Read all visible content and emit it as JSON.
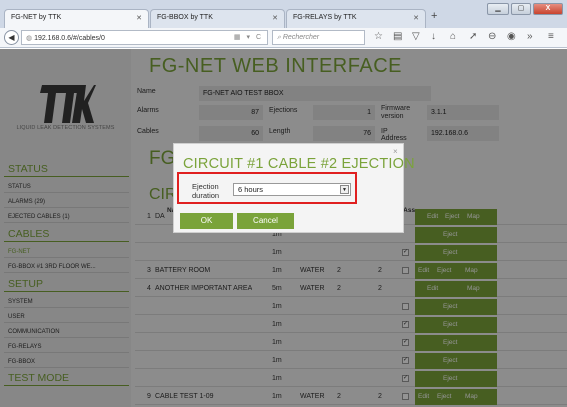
{
  "browser": {
    "tabs": [
      {
        "title": "FG-NET by TTK",
        "active": true
      },
      {
        "title": "FG-BBOX by TTK",
        "active": false
      },
      {
        "title": "FG-RELAYS by TTK",
        "active": false
      }
    ],
    "new_tab": "+",
    "address": "192.168.0.6/#/cables/0",
    "search_placeholder": "Rechercher"
  },
  "sidebar": {
    "logo_text": "TTK",
    "tagline": "LIQUID LEAK DETECTION SYSTEMS",
    "sections": [
      {
        "title": "STATUS",
        "items": [
          "STATUS",
          "ALARMS (29)",
          "EJECTED CABLES (1)"
        ]
      },
      {
        "title": "CABLES",
        "items": [
          "FG-NET",
          "FG-BBOX #1 3RD FLOOR WE..."
        ]
      },
      {
        "title": "SETUP",
        "items": [
          "SYSTEM",
          "USER",
          "COMMUNICATION",
          "FG-RELAYS",
          "FG-BBOX"
        ]
      },
      {
        "title": "TEST MODE",
        "items": []
      }
    ],
    "current_item": "FG-NET"
  },
  "main": {
    "title": "FG-NET WEB INTERFACE",
    "info": {
      "name_label": "Name",
      "name_value": "FG-NET AIO TEST BBOX",
      "alarms_label": "Alarms",
      "alarms_value": "87",
      "ejections_label": "Ejections",
      "ejections_value": "1",
      "firmware_label": "Firmware version",
      "firmware_value": "3.1.1",
      "cables_label": "Cables",
      "cables_value": "60",
      "length_label": "Length",
      "length_value": "76",
      "ip_label": "IP Address",
      "ip_value": "192.168.0.6"
    },
    "section_partial_1": "FG",
    "section_partial_2": "CIR",
    "grid_head_name": "Na",
    "grid_head_ass": "s  Ass.",
    "rows": [
      {
        "num": "1",
        "name": "DA",
        "length": "",
        "type": "",
        "a": "",
        "b": "",
        "checked": false,
        "show_check": false,
        "edit": "Edit",
        "eject": "Eject",
        "map": "Map",
        "layout": "hdr"
      },
      {
        "num": "",
        "name": "",
        "length": "1m",
        "type": "",
        "a": "",
        "b": "",
        "checked": false,
        "show_check": false,
        "edit": "",
        "eject": "Eject",
        "map": "",
        "layout": "sub"
      },
      {
        "num": "",
        "name": "",
        "length": "1m",
        "type": "",
        "a": "",
        "b": "",
        "checked": true,
        "show_check": true,
        "edit": "",
        "eject": "Eject",
        "map": "",
        "layout": "sub"
      },
      {
        "num": "3",
        "name": "BATTERY ROOM",
        "length": "1m",
        "type": "WATER",
        "a": "2",
        "b": "2",
        "checked": false,
        "show_check": true,
        "edit": "Edit",
        "eject": "Eject",
        "map": "Map",
        "layout": "full"
      },
      {
        "num": "4",
        "name": "ANOTHER IMPORTANT AREA",
        "length": "5m",
        "type": "WATER",
        "a": "2",
        "b": "2",
        "checked": false,
        "show_check": false,
        "edit": "Edit",
        "eject": "",
        "map": "Map",
        "layout": "hdr"
      },
      {
        "num": "",
        "name": "",
        "length": "1m",
        "type": "",
        "a": "",
        "b": "",
        "checked": false,
        "show_check": true,
        "edit": "",
        "eject": "Eject",
        "map": "",
        "layout": "sub"
      },
      {
        "num": "",
        "name": "",
        "length": "1m",
        "type": "",
        "a": "",
        "b": "",
        "checked": true,
        "show_check": true,
        "edit": "",
        "eject": "Eject",
        "map": "",
        "layout": "sub"
      },
      {
        "num": "",
        "name": "",
        "length": "1m",
        "type": "",
        "a": "",
        "b": "",
        "checked": true,
        "show_check": true,
        "edit": "",
        "eject": "Eject",
        "map": "",
        "layout": "sub"
      },
      {
        "num": "",
        "name": "",
        "length": "1m",
        "type": "",
        "a": "",
        "b": "",
        "checked": true,
        "show_check": true,
        "edit": "",
        "eject": "Eject",
        "map": "",
        "layout": "sub"
      },
      {
        "num": "",
        "name": "",
        "length": "1m",
        "type": "",
        "a": "",
        "b": "",
        "checked": true,
        "show_check": true,
        "edit": "",
        "eject": "Eject",
        "map": "",
        "layout": "sub"
      },
      {
        "num": "9",
        "name": "CABLE TEST 1-09",
        "length": "1m",
        "type": "WATER",
        "a": "2",
        "b": "2",
        "checked": false,
        "show_check": true,
        "edit": "Edit",
        "eject": "Eject",
        "map": "Map",
        "layout": "full"
      }
    ]
  },
  "modal": {
    "title": "CIRCUIT #1 CABLE #2 EJECTION",
    "close": "×",
    "field_label": "Ejection duration",
    "field_value": "6 hours",
    "ok_label": "OK",
    "cancel_label": "Cancel"
  },
  "colors": {
    "accent": "#7aa33a",
    "highlight": "#e02020"
  }
}
